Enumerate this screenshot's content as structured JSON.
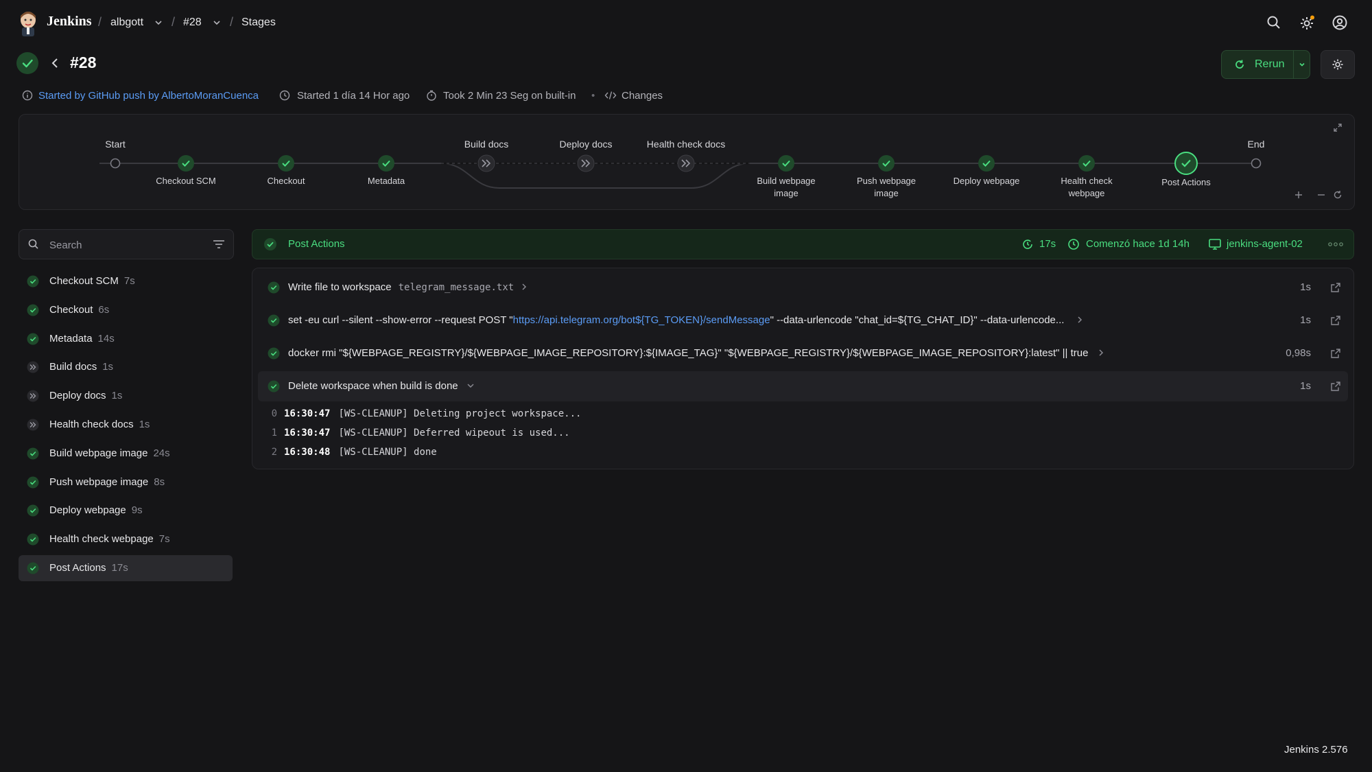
{
  "topbar": {
    "brand": "Jenkins",
    "crumbs": [
      "albgott",
      "#28",
      "Stages"
    ]
  },
  "header": {
    "title": "#28",
    "rerun_label": "Rerun"
  },
  "meta": {
    "started_by": "Started by GitHub push by AlbertoMoranCuenca",
    "started": "Started 1 día 14 Hor ago",
    "took": "Took 2 Min 23 Seg on built-in",
    "changes": "Changes"
  },
  "graph": {
    "start": "Start",
    "end": "End",
    "top_labels": [
      "Build docs",
      "Deploy docs",
      "Health check docs"
    ],
    "bottom_labels": [
      [
        "Checkout SCM"
      ],
      [
        "Checkout"
      ],
      [
        "Metadata"
      ],
      [
        "Build webpage",
        "image"
      ],
      [
        "Push webpage",
        "image"
      ],
      [
        "Deploy webpage"
      ],
      [
        "Health check",
        "webpage"
      ],
      [
        "Post Actions"
      ]
    ]
  },
  "sidebar": {
    "search_placeholder": "Search",
    "items": [
      {
        "name": "Checkout SCM",
        "dur": "7s",
        "status": "success"
      },
      {
        "name": "Checkout",
        "dur": "6s",
        "status": "success"
      },
      {
        "name": "Metadata",
        "dur": "14s",
        "status": "success"
      },
      {
        "name": "Build docs",
        "dur": "1s",
        "status": "skipped"
      },
      {
        "name": "Deploy docs",
        "dur": "1s",
        "status": "skipped"
      },
      {
        "name": "Health check docs",
        "dur": "1s",
        "status": "skipped"
      },
      {
        "name": "Build webpage image",
        "dur": "24s",
        "status": "success"
      },
      {
        "name": "Push webpage image",
        "dur": "8s",
        "status": "success"
      },
      {
        "name": "Deploy webpage",
        "dur": "9s",
        "status": "success"
      },
      {
        "name": "Health check webpage",
        "dur": "7s",
        "status": "success"
      },
      {
        "name": "Post Actions",
        "dur": "17s",
        "status": "success"
      }
    ]
  },
  "stage": {
    "title": "Post Actions",
    "duration": "17s",
    "started": "Comenzó hace 1d 14h",
    "agent": "jenkins-agent-02"
  },
  "steps": [
    {
      "text": "Write file to workspace",
      "arg": "telegram_message.txt",
      "dur": "1s"
    },
    {
      "pre": "set -eu curl --silent --show-error --request POST \"",
      "url": "https://api.telegram.org/bot${TG_TOKEN}/sendMessage",
      "post": "\" --data-urlencode \"chat_id=${TG_CHAT_ID}\" --data-urlencode...",
      "dur": "1s"
    },
    {
      "text": "docker rmi \"${WEBPAGE_REGISTRY}/${WEBPAGE_IMAGE_REPOSITORY}:${IMAGE_TAG}\" \"${WEBPAGE_REGISTRY}/${WEBPAGE_IMAGE_REPOSITORY}:latest\" || true",
      "dur": "0,98s"
    },
    {
      "text": "Delete workspace when build is done",
      "dur": "1s"
    }
  ],
  "log": [
    {
      "n": "0",
      "time": "16:30:47",
      "msg": "[WS-CLEANUP] Deleting project workspace..."
    },
    {
      "n": "1",
      "time": "16:30:47",
      "msg": "[WS-CLEANUP] Deferred wipeout is used..."
    },
    {
      "n": "2",
      "time": "16:30:48",
      "msg": "[WS-CLEANUP] done"
    }
  ],
  "footer": {
    "version": "Jenkins 2.576"
  },
  "colors": {
    "success": "#22c55e",
    "accent_link": "#5b9cf5",
    "background": "#151517"
  }
}
